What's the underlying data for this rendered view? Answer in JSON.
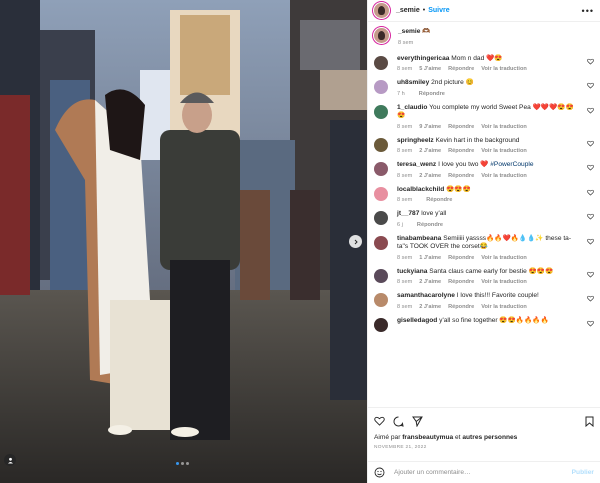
{
  "header": {
    "username": "_semie",
    "separator": "•",
    "follow_label": "Suivre",
    "more_icon": "more-horizontal-icon"
  },
  "caption": {
    "username": "_semie",
    "text": "🫶🏾",
    "time": "8 sem"
  },
  "comments": [
    {
      "username": "everythingericaa",
      "text": "Mom n dad ❤️😍",
      "time": "8 sem",
      "likes": "5 J'aime",
      "reply": "Répondre",
      "translate": "Voir la traduction",
      "avatar_color": "#5a4a44"
    },
    {
      "username": "uh8smiley",
      "text": "2nd picture 😊",
      "time": "7 h",
      "likes": "",
      "reply": "Répondre",
      "translate": "",
      "avatar_color": "#b79ac4"
    },
    {
      "username": "1_claudio",
      "text": "You complete my world Sweet Pea ❤️❤️❤️😍😍😍",
      "time": "8 sem",
      "likes": "9 J'aime",
      "reply": "Répondre",
      "translate": "Voir la traduction",
      "avatar_color": "#3f7a5c"
    },
    {
      "username": "springheelz",
      "text": "Kevin hart in the background",
      "time": "8 sem",
      "likes": "2 J'aime",
      "reply": "Répondre",
      "translate": "Voir la traduction",
      "avatar_color": "#6b5a3a"
    },
    {
      "username": "teresa_wenz",
      "text": "I love you two ❤️ #PowerCouple",
      "time": "8 sem",
      "likes": "2 J'aime",
      "reply": "Répondre",
      "translate": "Voir la traduction",
      "avatar_color": "#8a5a6a"
    },
    {
      "username": "localblackchild",
      "text": "😍😍😍",
      "time": "8 sem",
      "likes": "",
      "reply": "Répondre",
      "translate": "",
      "avatar_color": "#e88fa0"
    },
    {
      "username": "jt__787",
      "text": "love y'all",
      "time": "6 j",
      "likes": "",
      "reply": "Répondre",
      "translate": "",
      "avatar_color": "#4a4a4a"
    },
    {
      "username": "tinabambeana",
      "text": "Semiiiii yassss🔥🔥❤️🔥💧💧✨ these ta-ta\"s TOOK OVER the corset😂",
      "time": "8 sem",
      "likes": "1 J'aime",
      "reply": "Répondre",
      "translate": "Voir la traduction",
      "avatar_color": "#8a4a50"
    },
    {
      "username": "tuckyiana",
      "text": "Santa claus came early for bestie 😍😍😍",
      "time": "8 sem",
      "likes": "2 J'aime",
      "reply": "Répondre",
      "translate": "Voir la traduction",
      "avatar_color": "#5a4a5a"
    },
    {
      "username": "samanthacarolyne",
      "text": "I love this!!! Favorite couple!",
      "time": "8 sem",
      "likes": "2 J'aime",
      "reply": "Répondre",
      "translate": "Voir la traduction",
      "avatar_color": "#b88a6a"
    },
    {
      "username": "giselledagod",
      "text": "y'all so fine together 😍😍🔥🔥🔥🔥",
      "time": "",
      "likes": "",
      "reply": "",
      "translate": "",
      "avatar_color": "#3a2a2a"
    }
  ],
  "liked_by": {
    "prefix": "Aimé par",
    "user": "fransbeautymua",
    "suffix": "et",
    "others": "autres personnes"
  },
  "post_date": "NOVEMBRE 21, 2022",
  "add_comment": {
    "placeholder": "Ajouter un commentaire…",
    "post_label": "Publier",
    "emoji_icon": "smiley-icon"
  },
  "colors": {
    "accent": "#0095f6",
    "meta": "#8e8e8e",
    "post_disabled": "#b2dffc"
  }
}
